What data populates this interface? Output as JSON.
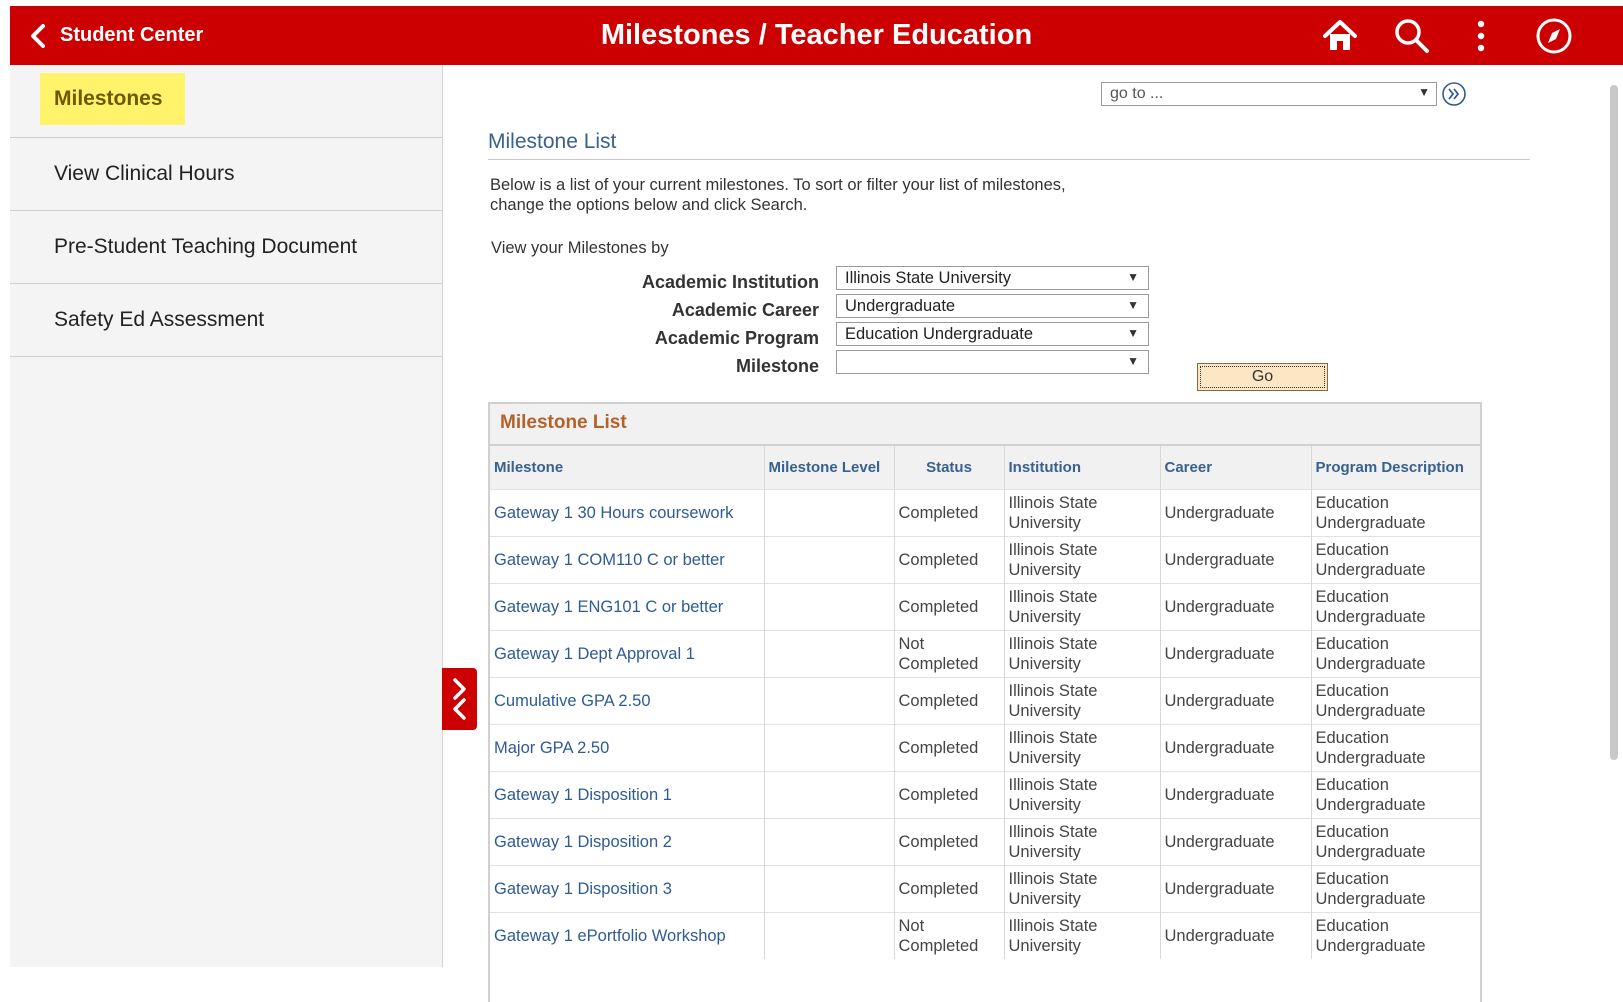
{
  "header": {
    "back_label": "Student Center",
    "title": "Milestones / Teacher Education",
    "icons": [
      "home-icon",
      "search-icon",
      "more-vertical-icon",
      "navbar-compass-icon"
    ],
    "color": "#cc0000"
  },
  "sidebar": {
    "items": [
      {
        "label": "Milestones",
        "active": true
      },
      {
        "label": "View Clinical Hours"
      },
      {
        "label": "Pre-Student Teaching Document"
      },
      {
        "label": "Safety Ed Assessment"
      }
    ]
  },
  "goto": {
    "value": "go to ..."
  },
  "section": {
    "title": "Milestone List",
    "intro": "Below is a list of your current milestones.  To sort or filter your list of milestones, change the options below and click Search.",
    "view_by": "View your Milestones by"
  },
  "filters": {
    "institution": {
      "label": "Academic Institution",
      "value": "Illinois State University"
    },
    "career": {
      "label": "Academic Career",
      "value": "Undergraduate"
    },
    "program": {
      "label": "Academic Program",
      "value": "Education Undergraduate"
    },
    "milestone": {
      "label": "Milestone",
      "value": ""
    },
    "go_label": "Go"
  },
  "grid": {
    "title": "Milestone List",
    "columns": [
      "Milestone",
      "Milestone Level",
      "Status",
      "Institution",
      "Career",
      "Program Description"
    ],
    "rows": [
      {
        "milestone": "Gateway 1 30 Hours coursework",
        "level": "",
        "status": "Completed",
        "institution": "Illinois State University",
        "career": "Undergraduate",
        "program": "Education Undergraduate"
      },
      {
        "milestone": "Gateway 1 COM110 C or better",
        "level": "",
        "status": "Completed",
        "institution": "Illinois State University",
        "career": "Undergraduate",
        "program": "Education Undergraduate"
      },
      {
        "milestone": "Gateway 1 ENG101 C or better",
        "level": "",
        "status": "Completed",
        "institution": "Illinois State University",
        "career": "Undergraduate",
        "program": "Education Undergraduate"
      },
      {
        "milestone": "Gateway 1 Dept Approval 1",
        "level": "",
        "status": "Not Completed",
        "institution": "Illinois State University",
        "career": "Undergraduate",
        "program": "Education Undergraduate"
      },
      {
        "milestone": "Cumulative GPA 2.50",
        "level": "",
        "status": "Completed",
        "institution": "Illinois State University",
        "career": "Undergraduate",
        "program": "Education Undergraduate"
      },
      {
        "milestone": "Major GPA 2.50",
        "level": "",
        "status": "Completed",
        "institution": "Illinois State University",
        "career": "Undergraduate",
        "program": "Education Undergraduate"
      },
      {
        "milestone": "Gateway 1 Disposition 1",
        "level": "",
        "status": "Completed",
        "institution": "Illinois State University",
        "career": "Undergraduate",
        "program": "Education Undergraduate"
      },
      {
        "milestone": "Gateway 1 Disposition 2",
        "level": "",
        "status": "Completed",
        "institution": "Illinois State University",
        "career": "Undergraduate",
        "program": "Education Undergraduate"
      },
      {
        "milestone": "Gateway 1 Disposition 3",
        "level": "",
        "status": "Completed",
        "institution": "Illinois State University",
        "career": "Undergraduate",
        "program": "Education Undergraduate"
      },
      {
        "milestone": "Gateway 1 ePortfolio Workshop",
        "level": "",
        "status": "Not Completed",
        "institution": "Illinois State University",
        "career": "Undergraduate",
        "program": "Education Undergraduate"
      }
    ]
  }
}
